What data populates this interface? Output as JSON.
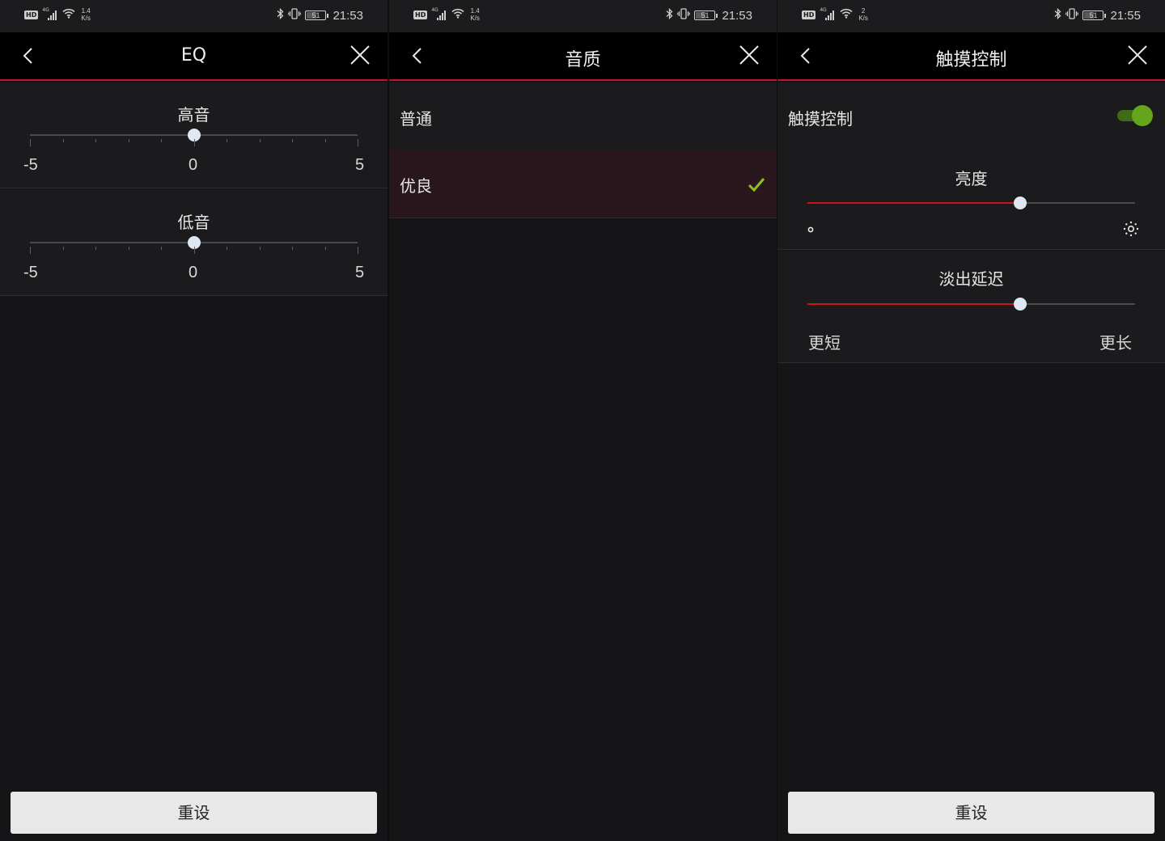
{
  "colors": {
    "accent_red": "#c4161c",
    "check_green": "#8bc21f",
    "toggle_green": "#64a51c",
    "slider_thumb": "#dfe8f2"
  },
  "screens": [
    {
      "status": {
        "hd": "HD",
        "network": "4G",
        "speed": "1.4",
        "speed_unit": "K/s",
        "battery": "51",
        "time": "21:53"
      },
      "title": "EQ",
      "back_icon": "chevron-left-icon",
      "close_icon": "close-icon",
      "sliders": [
        {
          "label": "高音",
          "min": -5,
          "max": 5,
          "value": 0,
          "min_label": "-5",
          "mid_label": "0",
          "max_label": "5"
        },
        {
          "label": "低音",
          "min": -5,
          "max": 5,
          "value": 0,
          "min_label": "-5",
          "mid_label": "0",
          "max_label": "5"
        }
      ],
      "reset_label": "重设"
    },
    {
      "status": {
        "hd": "HD",
        "network": "4G",
        "speed": "1.4",
        "speed_unit": "K/s",
        "battery": "51",
        "time": "21:53"
      },
      "title": "音质",
      "back_icon": "chevron-left-icon",
      "close_icon": "close-icon",
      "options": [
        {
          "label": "普通",
          "selected": false
        },
        {
          "label": "优良",
          "selected": true
        }
      ]
    },
    {
      "status": {
        "hd": "HD",
        "network": "4G",
        "speed": "2",
        "speed_unit": "K/s",
        "battery": "51",
        "time": "21:55"
      },
      "title": "触摸控制",
      "back_icon": "chevron-left-icon",
      "close_icon": "close-icon",
      "toggle": {
        "label": "触摸控制",
        "on": true
      },
      "brightness": {
        "label": "亮度",
        "value": 0.65,
        "min_icon": "dim-dot-icon",
        "max_icon": "brightness-sun-icon"
      },
      "fade_delay": {
        "label": "淡出延迟",
        "value": 0.65,
        "min_label": "更短",
        "max_label": "更长"
      },
      "reset_label": "重设"
    }
  ]
}
